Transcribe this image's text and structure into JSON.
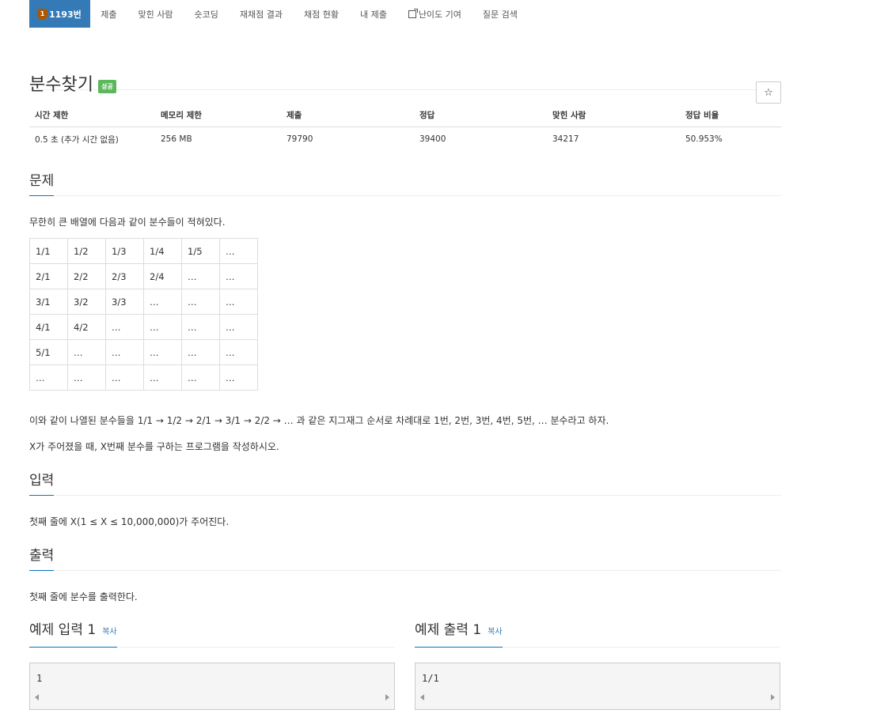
{
  "nav": {
    "problem_badge": "1",
    "problem": "1193번",
    "items": [
      "제출",
      "맞힌 사람",
      "숏코딩",
      "재채점 결과",
      "채점 현황",
      "내 제출",
      "난이도 기여",
      "질문 검색"
    ]
  },
  "title": "분수찾기",
  "status_badge": "성공",
  "star_icon": "☆",
  "info": {
    "headers": [
      "시간 제한",
      "메모리 제한",
      "제출",
      "정답",
      "맞힌 사람",
      "정답 비율"
    ],
    "values": [
      "0.5 초 (추가 시간 없음)",
      "256 MB",
      "79790",
      "39400",
      "34217",
      "50.953%"
    ]
  },
  "problem": {
    "heading": "문제",
    "intro": "무한히 큰 배열에 다음과 같이 분수들이 적혀있다.",
    "table": [
      [
        "1/1",
        "1/2",
        "1/3",
        "1/4",
        "1/5",
        "…"
      ],
      [
        "2/1",
        "2/2",
        "2/3",
        "2/4",
        "…",
        "…"
      ],
      [
        "3/1",
        "3/2",
        "3/3",
        "…",
        "…",
        "…"
      ],
      [
        "4/1",
        "4/2",
        "…",
        "…",
        "…",
        "…"
      ],
      [
        "5/1",
        "…",
        "…",
        "…",
        "…",
        "…"
      ],
      [
        "…",
        "…",
        "…",
        "…",
        "…",
        "…"
      ]
    ],
    "desc1": "이와 같이 나열된 분수들을 1/1 → 1/2 → 2/1 → 3/1 → 2/2 → … 과 같은 지그재그 순서로 차례대로 1번, 2번, 3번, 4번, 5번, … 분수라고 하자.",
    "desc2": "X가 주어졌을 때, X번째 분수를 구하는 프로그램을 작성하시오."
  },
  "input": {
    "heading": "입력",
    "text": "첫째 줄에 X(1 ≤ X ≤ 10,000,000)가 주어진다."
  },
  "output": {
    "heading": "출력",
    "text": "첫째 줄에 분수를 출력한다."
  },
  "samples": {
    "input_title": "예제 입력 1",
    "output_title": "예제 출력 1",
    "copy_label": "복사",
    "input_value": "1",
    "output_value": "1/1"
  }
}
